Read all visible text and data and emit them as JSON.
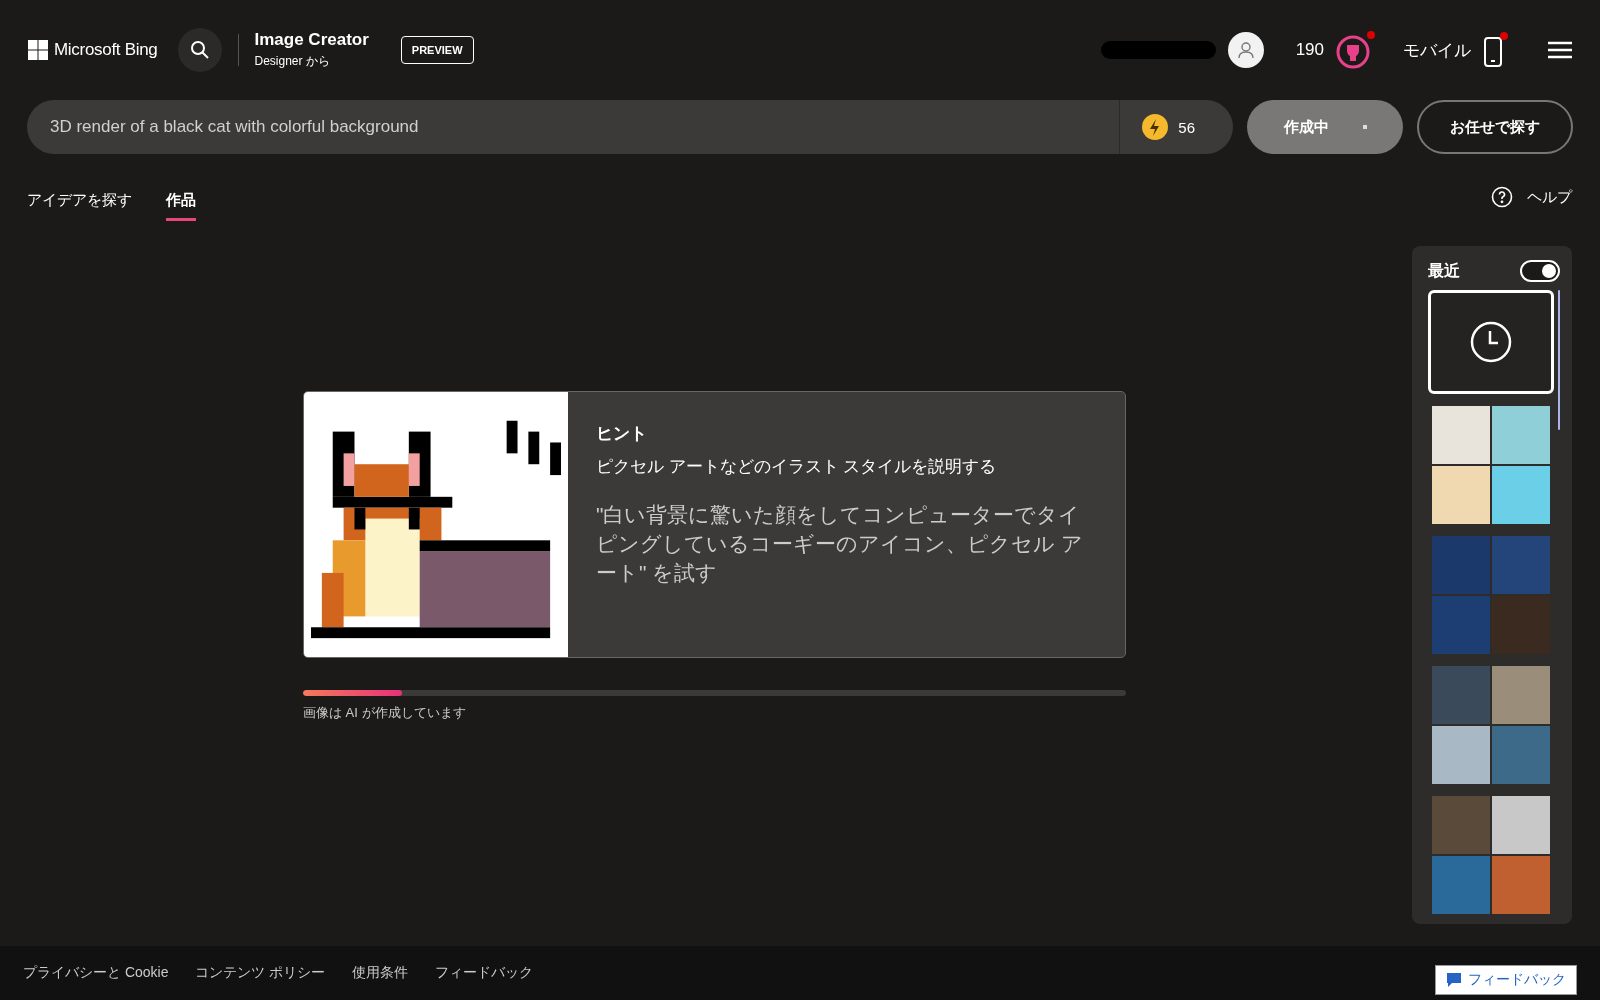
{
  "header": {
    "brand": "Microsoft Bing",
    "product_title": "Image Creator",
    "product_subtitle": "Designer から",
    "badge": "PREVIEW",
    "points": "190",
    "mobile": "モバイル"
  },
  "prompt": {
    "value": "3D render of a black cat with colorful background",
    "boosts": "56",
    "create_button": "作成中",
    "surprise_button": "お任せで探す"
  },
  "tabs": [
    {
      "label": "アイデアを探す",
      "selected": false
    },
    {
      "label": "作品",
      "selected": true
    }
  ],
  "help": "ヘルプ",
  "hint": {
    "title": "ヒント",
    "subtitle": "ピクセル アートなどのイラスト スタイルを説明する",
    "example": "\"白い背景に驚いた顔をしてコンピューターでタイピングしているコーギーのアイコン、ピクセル アート\" を試す"
  },
  "progress": {
    "level": 0.12,
    "caption": "画像は AI が作成しています"
  },
  "recent": {
    "title": "最近",
    "on": true
  },
  "footer": {
    "links": [
      "プライバシーと Cookie",
      "コンテンツ ポリシー",
      "使用条件",
      "フィードバック"
    ],
    "feedback_button": "フィードバック"
  }
}
